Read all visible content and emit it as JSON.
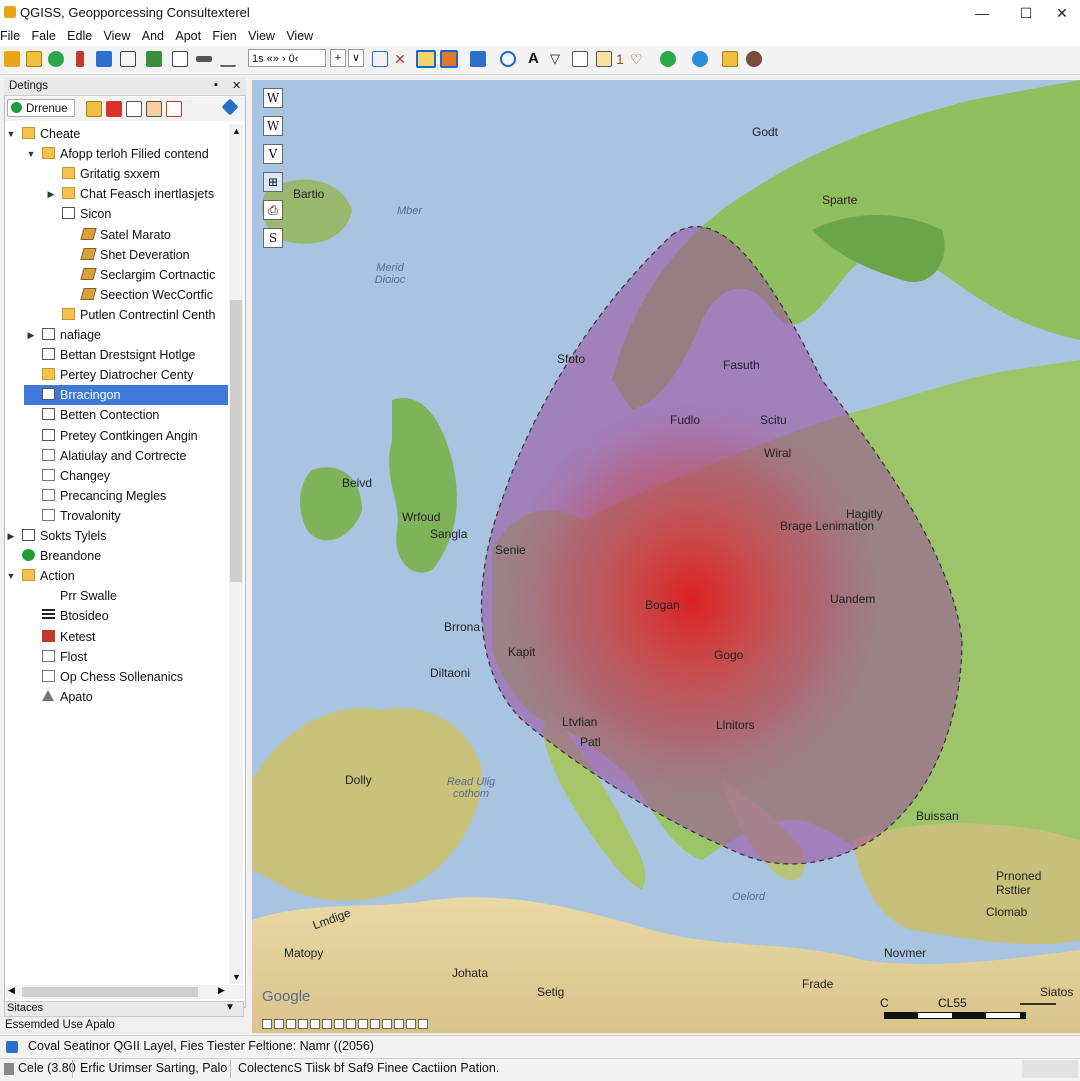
{
  "window": {
    "title": "QGISS, Geopporcessing Consultexterel",
    "minimize": "—",
    "maximize": "☐",
    "close": "✕"
  },
  "menu": [
    "File",
    "Fale",
    "Edle",
    "View",
    "And",
    "Apot",
    "Fien",
    "View",
    "View"
  ],
  "toolbar": {
    "coord_text": "1s «» › 0‹",
    "plus": "+",
    "caret": "∨",
    "text_tool": "A",
    "icon_number": "1"
  },
  "panel": {
    "title": "Detings",
    "pin": "▪",
    "close": "✕",
    "filter_label": "Drrenue",
    "tree": [
      {
        "label": "Cheate",
        "level": 0,
        "arrow": "▼",
        "icon": "folder"
      },
      {
        "label": "Afopp terloh Filied contend",
        "level": 1,
        "arrow": "▼",
        "icon": "folder"
      },
      {
        "label": "Gritatig sxxem",
        "level": 2,
        "arrow": "",
        "icon": "folder"
      },
      {
        "label": "Chat Feasch inertlasjets",
        "level": 2,
        "arrow": "▶",
        "icon": "folder"
      },
      {
        "label": "Sicon",
        "level": 2,
        "arrow": "",
        "icon": "table"
      },
      {
        "label": "Satel Marato",
        "level": 3,
        "arrow": "",
        "icon": "layer"
      },
      {
        "label": "Shet Deveration",
        "level": 3,
        "arrow": "",
        "icon": "layer"
      },
      {
        "label": "Seclargim Cortnactic",
        "level": 3,
        "arrow": "",
        "icon": "layer"
      },
      {
        "label": "Seection WecCortfic",
        "level": 3,
        "arrow": "",
        "icon": "layer"
      },
      {
        "label": "Putlen Contrectinl Centh",
        "level": 2,
        "arrow": "",
        "icon": "folder"
      },
      {
        "label": "nafiage",
        "level": 1,
        "arrow": "▶",
        "icon": "table"
      },
      {
        "label": "Bettan Drestsignt Hotlge",
        "level": 1,
        "arrow": "",
        "icon": "table"
      },
      {
        "label": "Pertey Diatrocher Centy",
        "level": 1,
        "arrow": "",
        "icon": "folder"
      },
      {
        "label": "Brracingon",
        "level": 1,
        "arrow": "",
        "icon": "table",
        "selected": true
      },
      {
        "label": "Betten Contection",
        "level": 1,
        "arrow": "",
        "icon": "table"
      },
      {
        "label": "Pretey Contkingen Angin",
        "level": 1,
        "arrow": "",
        "icon": "table"
      },
      {
        "label": "Alatiulay and Cortrecte",
        "level": 1,
        "arrow": "",
        "icon": "doc"
      },
      {
        "label": "Changey",
        "level": 1,
        "arrow": "",
        "icon": "doc"
      },
      {
        "label": "Precancing Megles",
        "level": 1,
        "arrow": "",
        "icon": "doc"
      },
      {
        "label": "Trovalonity",
        "level": 1,
        "arrow": "",
        "icon": "doc"
      },
      {
        "label": "Sokts Tylels",
        "level": 0,
        "arrow": "▶",
        "icon": "table"
      },
      {
        "label": "Breandone",
        "level": 0,
        "arrow": "",
        "icon": "green"
      },
      {
        "label": "Action",
        "level": 0,
        "arrow": "▼",
        "icon": "folder"
      },
      {
        "label": "Prr Swalle",
        "level": 1,
        "arrow": "",
        "icon": "none"
      },
      {
        "label": "Btosideo",
        "level": 1,
        "arrow": "",
        "icon": "stripes"
      },
      {
        "label": "Ketest",
        "level": 1,
        "arrow": "",
        "icon": "flag"
      },
      {
        "label": "Flost",
        "level": 1,
        "arrow": "",
        "icon": "doc"
      },
      {
        "label": "Op Chess Sollenanics",
        "level": 1,
        "arrow": "",
        "icon": "doc"
      },
      {
        "label": "Apato",
        "level": 1,
        "arrow": "",
        "icon": "warn"
      }
    ]
  },
  "panel2": {
    "title": "Sitaces",
    "row": "Essemded Use Apalo"
  },
  "map": {
    "tools": [
      "W",
      "W",
      "V",
      "⊞",
      "⎙",
      "S"
    ],
    "labels": [
      "Godt",
      "Sparte",
      "Bartio",
      "Fasuth",
      "Fudlo",
      "Sfoto",
      "Scitu",
      "Wiral",
      "Brage Lenimation",
      "Hagitly",
      "Beivd",
      "Wrfoud",
      "Sangla",
      "Senie",
      "Brrona",
      "Bogan",
      "Kapit",
      "Diltaoni",
      "Uandem",
      "Gogo",
      "Ltvfian",
      "Patl",
      "Llnitors",
      "Dolly",
      "Buissan",
      "Prnoned Rsttier",
      "Clomab",
      "Matopy",
      "Johata",
      "Setig",
      "Frade",
      "Novmer",
      "Lmdige",
      "Siatos"
    ],
    "sea_labels": [
      "Mber",
      "Merid Dioioc",
      "Read Ulig cothom",
      "Oelord"
    ],
    "google": "Google",
    "scale_left": "C",
    "scale_right": "CL55"
  },
  "status": {
    "line1": "Coval Seatinor QGII Layel, Fies Tiester Feltione:  Namr ((2056)",
    "field1": "Cele (3.80",
    "field2": "Erfic Urimser Sarting, Palo",
    "field3": "ColectencS Tiisk bf Saf9 Finee Cactiion Pation."
  },
  "colors": {
    "selection": "#3f78d6",
    "heat_core": "#e01b1b",
    "zone_fill": "#9b4a9e",
    "sea": "#a8c4e0",
    "land": "#8fbf5f"
  }
}
